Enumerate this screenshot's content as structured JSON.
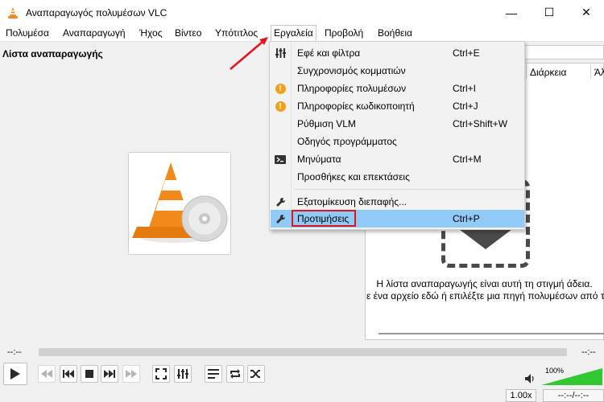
{
  "window": {
    "title": "Αναπαραγωγός πολυμέσων VLC",
    "minimize_glyph": "—",
    "maximize_glyph": "☐",
    "close_glyph": "✕"
  },
  "menubar": {
    "items": [
      "Πολυμέσα",
      "Αναπαραγωγή",
      "Ήχος",
      "Βίντεο",
      "Υπότιτλος",
      "Εργαλεία",
      "Προβολή",
      "Βοήθεια"
    ],
    "active": "Εργαλεία"
  },
  "playlist": {
    "title": "Λίστα αναπαραγωγής",
    "columns": [
      "Διάρκεια",
      "Άλ"
    ],
    "empty_line1": "Η λίστα αναπαραγωγής είναι αυτή τη στιγμή άδεια.",
    "empty_line2": "ε ένα αρχείο εδώ ή επιλέξτε μια πηγή πολυμέσων από τ"
  },
  "tools_menu": {
    "items": [
      {
        "label": "Εφέ και φίλτρα",
        "shortcut": "Ctrl+E",
        "icon": "equalizer-icon"
      },
      {
        "label": "Συγχρονισμός κομματιών",
        "shortcut": "",
        "icon": ""
      },
      {
        "label": "Πληροφορίες πολυμέσων",
        "shortcut": "Ctrl+I",
        "icon": "info-icon"
      },
      {
        "label": "Πληροφορίες κωδικοποιητή",
        "shortcut": "Ctrl+J",
        "icon": "info-icon"
      },
      {
        "label": "Ρύθμιση VLM",
        "shortcut": "Ctrl+Shift+W",
        "icon": ""
      },
      {
        "label": "Οδηγός προγράμματος",
        "shortcut": "",
        "icon": ""
      },
      {
        "label": "Μηνύματα",
        "shortcut": "Ctrl+M",
        "icon": "terminal-icon"
      },
      {
        "label": "Προσθήκες και επεκτάσεις",
        "shortcut": "",
        "icon": ""
      },
      {
        "label": "Εξατομίκευση διεπαφής...",
        "shortcut": "",
        "icon": "wrench-icon"
      },
      {
        "label": "Προτιμήσεις",
        "shortcut": "Ctrl+P",
        "icon": "wrench-icon",
        "selected": true
      }
    ]
  },
  "player": {
    "elapsed": "--:--",
    "remaining": "--:--",
    "volume_percent": "100%",
    "volume_level": 1.0,
    "speed": "1.00x",
    "time_display": "--:--/--:--"
  },
  "colors": {
    "menu_highlight": "#91c9f7",
    "annotation_red": "#e0141e",
    "volume_green": "#32c832",
    "vlc_orange": "#f08a1a"
  }
}
